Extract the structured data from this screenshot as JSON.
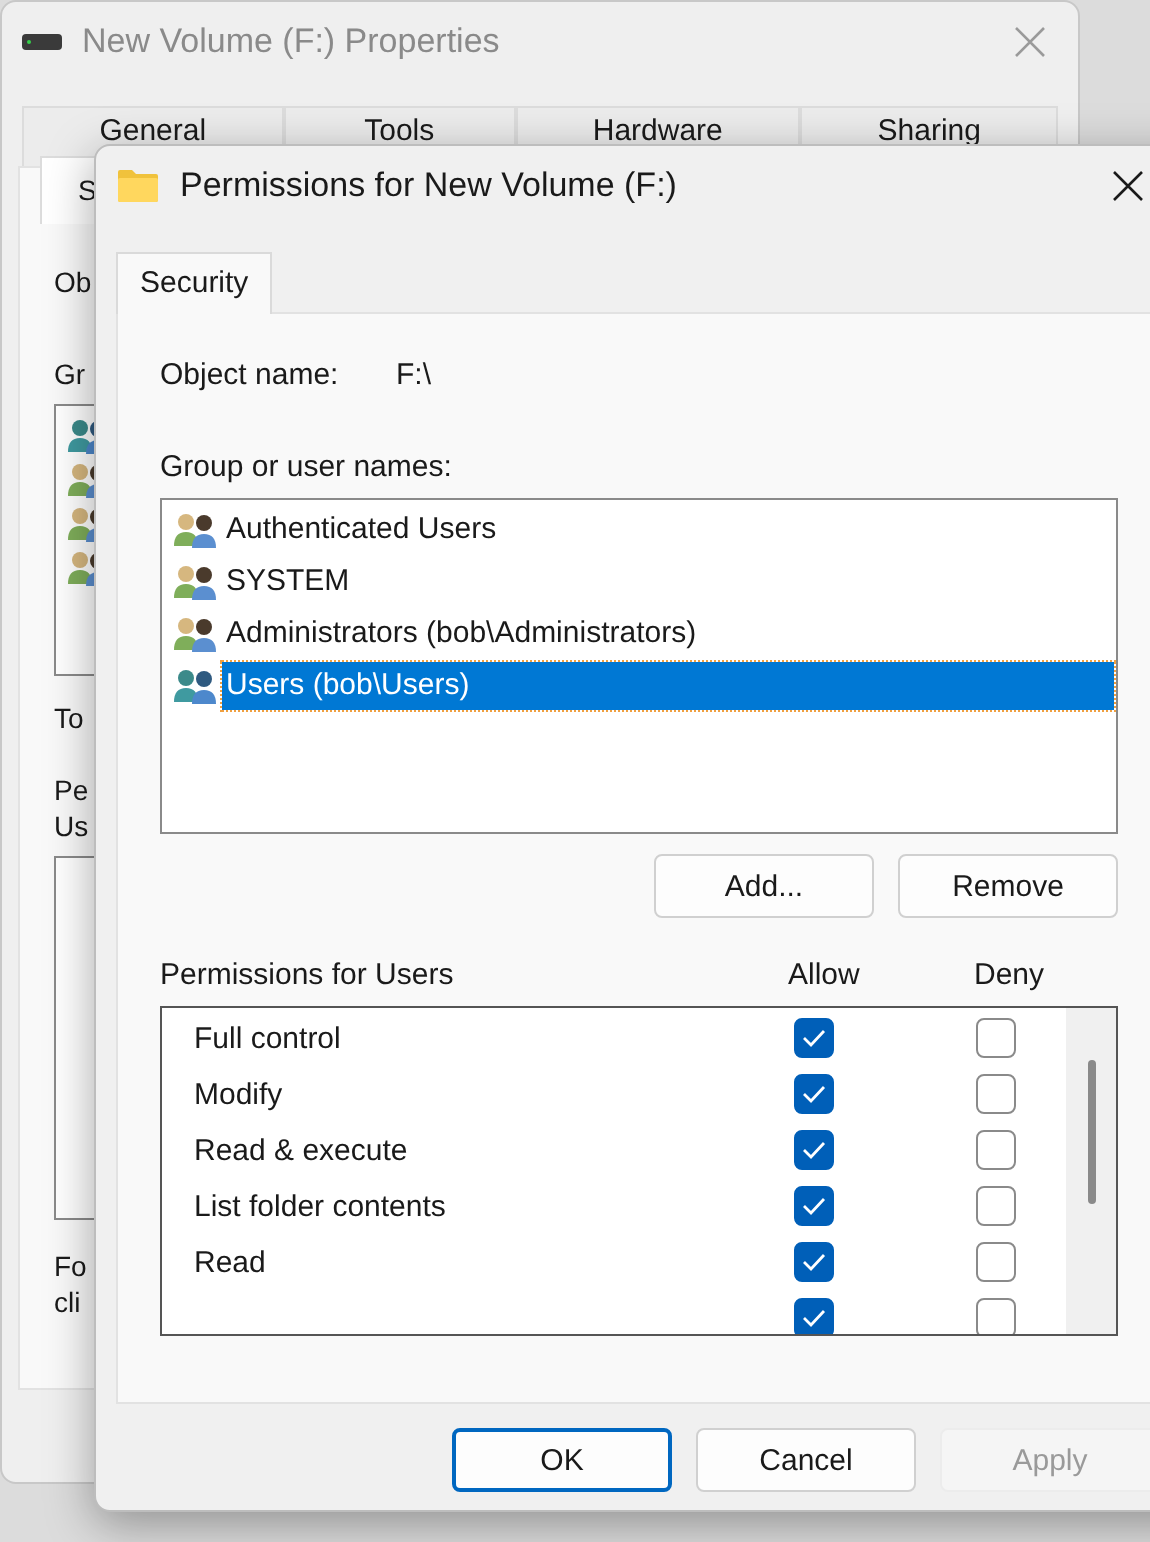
{
  "background_window": {
    "title": "New Volume (F:) Properties",
    "tabs": [
      {
        "label": "General",
        "selected": false
      },
      {
        "label": "Tools",
        "selected": false
      },
      {
        "label": "Hardware",
        "selected": false
      },
      {
        "label": "Sharing",
        "selected": false
      },
      {
        "label": "S",
        "selected": true
      }
    ],
    "object_label": "Ob",
    "group_label": "Gr",
    "list_items": [
      {
        "kind": "teal"
      },
      {
        "kind": "mixed"
      },
      {
        "kind": "mixed"
      },
      {
        "kind": "mixed"
      }
    ],
    "hint": "To",
    "permissions_label": [
      "Pe",
      "Us"
    ],
    "footer": [
      "Fo",
      "cli"
    ]
  },
  "window": {
    "title": "Permissions for New Volume (F:)",
    "tabs": [
      {
        "label": "Security",
        "selected": true
      }
    ],
    "object_name_label": "Object name:",
    "object_name": "F:\\",
    "group_label": "Group or user names:",
    "users": [
      {
        "name": "Authenticated Users",
        "kind": "mixed",
        "selected": false
      },
      {
        "name": "SYSTEM",
        "kind": "mixed",
        "selected": false
      },
      {
        "name": "Administrators (bob\\Administrators)",
        "kind": "mixed",
        "selected": false
      },
      {
        "name": "Users (bob\\Users)",
        "kind": "teal",
        "selected": true
      }
    ],
    "user_buttons": [
      "Add...",
      "Remove"
    ],
    "permissions": {
      "title": "Permissions for Users",
      "allow_label": "Allow",
      "deny_label": "Deny",
      "rows": [
        {
          "label": "Full control",
          "allow": true,
          "deny": false
        },
        {
          "label": "Modify",
          "allow": true,
          "deny": false
        },
        {
          "label": "Read & execute",
          "allow": true,
          "deny": false
        },
        {
          "label": "List folder contents",
          "allow": true,
          "deny": false
        },
        {
          "label": "Read",
          "allow": true,
          "deny": false
        },
        {
          "allow": true,
          "deny": false
        }
      ]
    },
    "buttons": [
      {
        "label": "OK",
        "kind": "default"
      },
      {
        "label": "Cancel",
        "kind": "normal"
      },
      {
        "label": "Apply",
        "kind": "disabled"
      }
    ]
  }
}
